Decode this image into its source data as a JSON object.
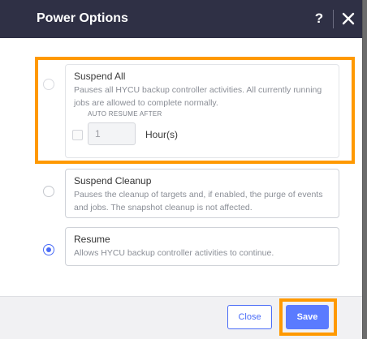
{
  "dialog": {
    "title": "Power Options",
    "help_label": "?",
    "close_icon": "close-icon"
  },
  "options": [
    {
      "title": "Suspend All",
      "description": "Pauses all HYCU backup controller activities. All currently running jobs are allowed to complete normally.",
      "selected": false
    },
    {
      "title": "Suspend Cleanup",
      "description": "Pauses the cleanup of targets and, if enabled, the purge of events and jobs. The snapshot cleanup is not affected.",
      "selected": false
    },
    {
      "title": "Resume",
      "description": "Allows HYCU backup controller activities to continue.",
      "selected": true
    }
  ],
  "auto_resume": {
    "label": "AUTO RESUME AFTER",
    "value": "1",
    "unit": "Hour(s)",
    "checked": false
  },
  "footer": {
    "close_label": "Close",
    "save_label": "Save"
  },
  "colors": {
    "header_bg": "#2f3045",
    "accent": "#4a6cf7",
    "save_bg": "#5a7bff",
    "highlight": "#ff9900"
  }
}
